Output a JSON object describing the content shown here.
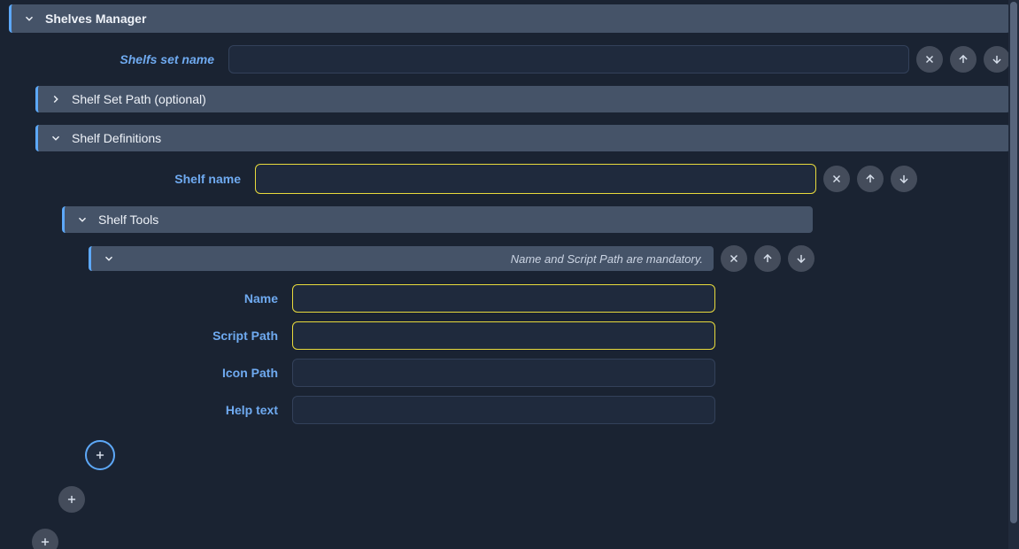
{
  "header": {
    "title": "Shelves Manager"
  },
  "shelfsSetName": {
    "label": "Shelfs set name",
    "value": ""
  },
  "shelfSetPath": {
    "title": "Shelf Set Path (optional)"
  },
  "shelfDefinitions": {
    "title": "Shelf Definitions",
    "shelfName": {
      "label": "Shelf name",
      "value": ""
    },
    "shelfTools": {
      "title": "Shelf Tools",
      "item": {
        "message": "Name and Script Path are mandatory.",
        "fields": {
          "name": {
            "label": "Name",
            "value": ""
          },
          "scriptPath": {
            "label": "Script Path",
            "value": ""
          },
          "iconPath": {
            "label": "Icon Path",
            "value": ""
          },
          "helpText": {
            "label": "Help text",
            "value": ""
          }
        }
      }
    }
  }
}
